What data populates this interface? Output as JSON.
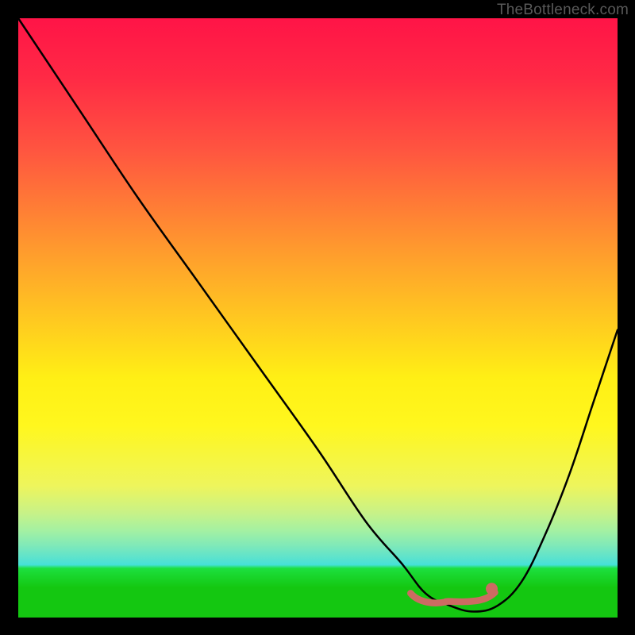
{
  "attribution": {
    "text": "TheBottleneck.com"
  },
  "colors": {
    "background": "#000000",
    "curve": "#000000",
    "marker": "#cc6b62",
    "marker_stroke": "#cc6b62",
    "attribution_text": "#595959"
  },
  "chart_data": {
    "type": "line",
    "title": "",
    "xlabel": "",
    "ylabel": "",
    "xlim": [
      0,
      100
    ],
    "ylim": [
      0,
      100
    ],
    "comment": "Depicts a bottleneck / mismatch curve. X axis ≈ relative component strength; Y axis ≈ bottleneck % (0 at bottom, 100 at top). Minimum plateau around x≈68–80 indicates balanced region. Background hue maps to bottleneck severity (green=good, red=bad).",
    "series": [
      {
        "name": "bottleneck_curve",
        "x": [
          0,
          10,
          20,
          30,
          40,
          50,
          58,
          64,
          68,
          72,
          76,
          80,
          84,
          88,
          92,
          96,
          100
        ],
        "y": [
          100,
          85,
          70,
          56,
          42,
          28,
          16,
          9,
          4,
          2,
          1,
          2,
          6,
          14,
          24,
          36,
          48
        ]
      }
    ],
    "optimal_region": {
      "x_start": 66,
      "x_end": 79,
      "y": 3,
      "endpoint_primary": {
        "x": 79,
        "y": 4
      }
    },
    "gradient_stops": [
      {
        "pct": 0,
        "color": "#ff1447"
      },
      {
        "pct": 40,
        "color": "#ffa02c"
      },
      {
        "pct": 63,
        "color": "#fff71e"
      },
      {
        "pct": 90,
        "color": "#45e1d8"
      },
      {
        "pct": 95,
        "color": "#14c711"
      }
    ]
  }
}
